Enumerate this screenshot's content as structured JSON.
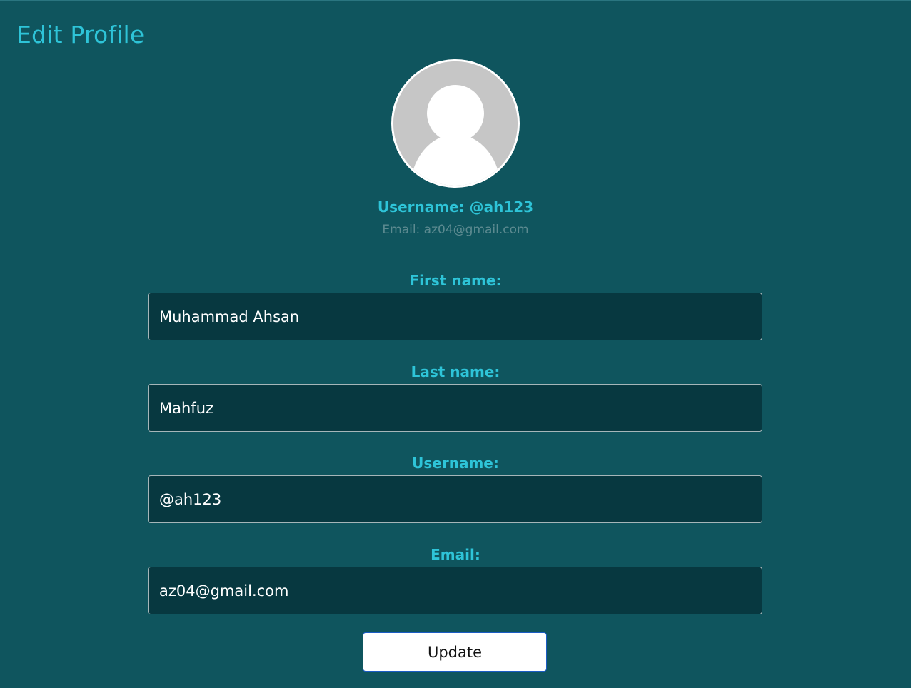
{
  "page": {
    "title": "Edit Profile"
  },
  "profile": {
    "avatar_icon": "default-user-avatar-icon",
    "username_line": "Username: @ah123",
    "email_line": "Email: az04@gmail.com"
  },
  "form": {
    "first_name": {
      "label": "First name:",
      "value": "Muhammad Ahsan"
    },
    "last_name": {
      "label": "Last name:",
      "value": "Mahfuz"
    },
    "username": {
      "label": "Username:",
      "value": "@ah123"
    },
    "email": {
      "label": "Email:",
      "value": "az04@gmail.com"
    },
    "submit_label": "Update"
  },
  "colors": {
    "background": "#0f555e",
    "accent": "#2ec4d8",
    "input_background": "#073840",
    "muted_text": "#5c8a90"
  }
}
